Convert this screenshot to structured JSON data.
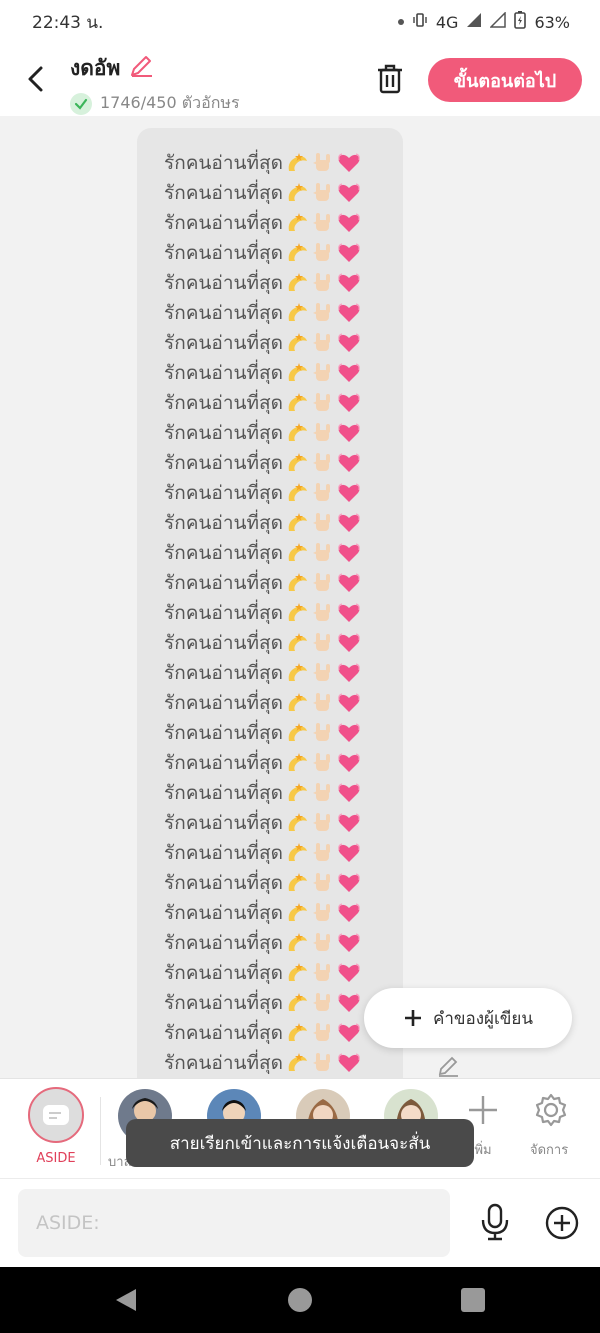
{
  "status": {
    "time": "22:43 น.",
    "network": "4G",
    "battery": "63%"
  },
  "header": {
    "title": "งดอัพ",
    "counter": "1746/450 ตัวอักษร",
    "next_button": "ขั้นตอนต่อไป"
  },
  "message": {
    "lines": [
      "รักคนอ่านที่สุด",
      "รักคนอ่านที่สุด",
      "รักคนอ่านที่สุด",
      "รักคนอ่านที่สุด",
      "รักคนอ่านที่สุด",
      "รักคนอ่านที่สุด",
      "รักคนอ่านที่สุด",
      "รักคนอ่านที่สุด",
      "รักคนอ่านที่สุด",
      "รักคนอ่านที่สุด",
      "รักคนอ่านที่สุด",
      "รักคนอ่านที่สุด",
      "รักคนอ่านที่สุด",
      "รักคนอ่านที่สุด",
      "รักคนอ่านที่สุด",
      "รักคนอ่านที่สุด",
      "รักคนอ่านที่สุด",
      "รักคนอ่านที่สุด",
      "รักคนอ่านที่สุด",
      "รักคนอ่านที่สุด",
      "รักคนอ่านที่สุด",
      "รักคนอ่านที่สุด",
      "รักคนอ่านที่สุด",
      "รักคนอ่านที่สุด",
      "รักคนอ่านที่สุด",
      "รักคนอ่านที่สุด",
      "รักคนอ่านที่สุด",
      "รักคนอ่านที่สุด",
      "รักคนอ่านที่สุด",
      "รักคนอ่านที่สุด",
      "รักคนอ่านที่สุด",
      "รักคนอ่านที่สุด"
    ],
    "emojis": [
      "dizzy-star-icon",
      "rock-hand-icon",
      "heart-icon"
    ]
  },
  "fab": {
    "label": "คำของผู้เขียน"
  },
  "characters": {
    "aside_label": "ASIDE",
    "items": [
      {
        "label": "บาล",
        "icon": "avatar-1"
      },
      {
        "label": "",
        "icon": "avatar-2"
      },
      {
        "label": "",
        "icon": "avatar-3"
      },
      {
        "label": "",
        "icon": "avatar-4"
      }
    ],
    "add_label": "เพิ่ม",
    "manage_label": "จัดการ"
  },
  "toast": "สายเรียกเข้าและการแจ้งเตือนจะสั่น",
  "input": {
    "placeholder": "ASIDE:"
  },
  "colors": {
    "accent": "#f15a7a",
    "aside_red": "#e0405a"
  }
}
